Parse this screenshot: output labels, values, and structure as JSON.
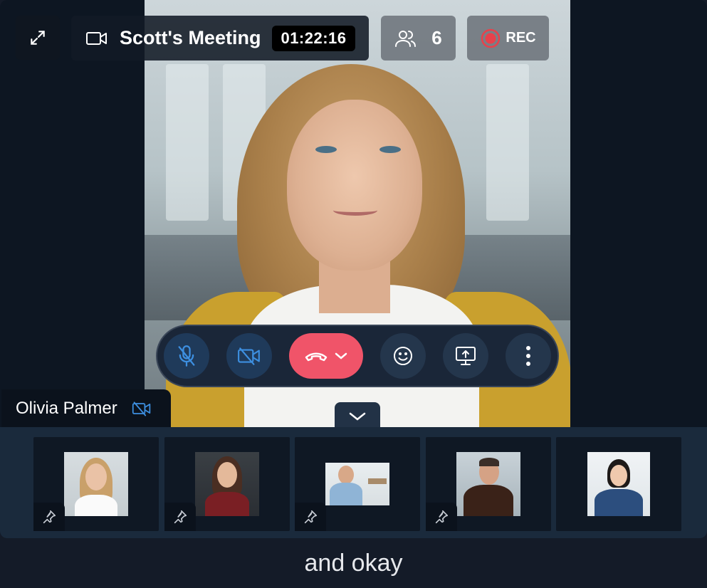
{
  "header": {
    "meeting_title": "Scott's Meeting",
    "timer": "01:22:16",
    "participant_count": "6",
    "record_label": "REC"
  },
  "main_speaker": {
    "name": "Olivia Palmer"
  },
  "colors": {
    "end_call": "#f05469",
    "accent_blue": "#3d8fe0",
    "record_red": "#e8414b"
  },
  "icons": {
    "expand": "expand-icon",
    "meeting": "video-camera-icon",
    "participants": "people-icon",
    "record": "record-icon",
    "mic": "mic-off-icon",
    "camera": "camera-off-icon",
    "end_call": "phone-hangup-icon",
    "reactions": "smiley-icon",
    "share": "screen-share-icon",
    "more": "more-vertical-icon",
    "collapse": "chevron-down-icon",
    "pin": "pin-icon"
  },
  "caption": "and okay"
}
